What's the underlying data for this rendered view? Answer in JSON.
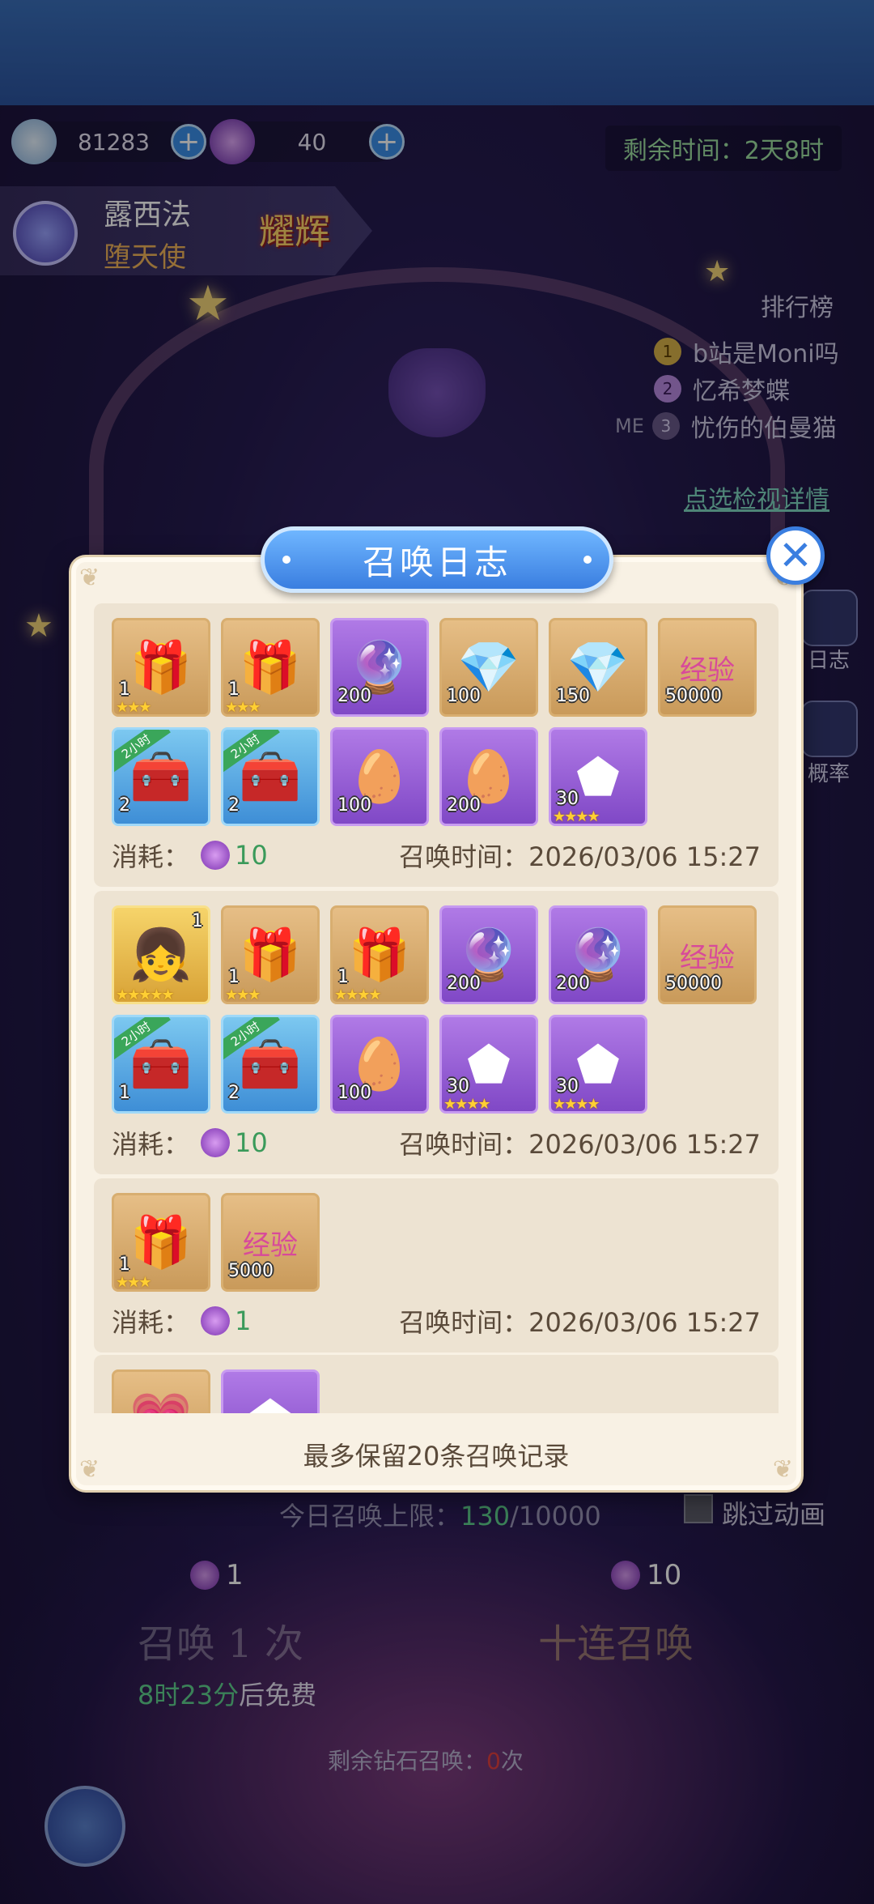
{
  "hud": {
    "coins": "81283",
    "gems": "40",
    "remaining_time": "剩余时间：2天8时"
  },
  "hero": {
    "name": "露西法",
    "title": "堕天使",
    "badge": "耀辉"
  },
  "ranking": {
    "title": "排行榜",
    "entries": [
      {
        "rank": "1",
        "name": "b站是Moni吗"
      },
      {
        "rank": "2",
        "name": "忆希梦蝶"
      },
      {
        "rank": "3",
        "name": "忧伤的伯曼猫"
      }
    ],
    "me_label": "ME",
    "detail_link": "点选检视详情"
  },
  "side_buttons": [
    {
      "label": "日志"
    },
    {
      "label": "概率"
    }
  ],
  "background_ui": {
    "daily_limit_label": "今日召唤上限：",
    "daily_limit_used": "130",
    "daily_limit_max": "/10000",
    "skip_animation": "跳过动画",
    "cost_single": "1",
    "cost_ten": "10",
    "summon_once": "召唤 1 次",
    "summon_ten": "十连召唤",
    "free_countdown": "8时23分",
    "free_suffix": "后免费",
    "diamond_left_label": "剩余钻石召唤：",
    "diamond_left_value": "0",
    "diamond_left_unit": "次"
  },
  "dialog": {
    "title": "召唤日志",
    "note": "最多保留20条召唤记录",
    "cost_label": "消耗：",
    "time_label": "召唤时间：",
    "records": [
      {
        "cost": "10",
        "time": "2026/03/06 15:27",
        "items": [
          {
            "kind": "mystery-box",
            "bg": "gold",
            "qty": "1",
            "stars": "★★★"
          },
          {
            "kind": "mystery-box",
            "bg": "gold",
            "qty": "1",
            "stars": "★★★"
          },
          {
            "kind": "crystal-ball",
            "bg": "purple",
            "qty": "200"
          },
          {
            "kind": "gem",
            "bg": "gold",
            "qty": "100"
          },
          {
            "kind": "gem",
            "bg": "gold",
            "qty": "150"
          },
          {
            "kind": "exp-heart",
            "bg": "gold",
            "qty": "50000",
            "text": "经验"
          },
          {
            "kind": "timed-chest",
            "bg": "blue",
            "qty": "2",
            "tag": "2小时"
          },
          {
            "kind": "timed-chest",
            "bg": "blue",
            "qty": "2",
            "tag": "2小时"
          },
          {
            "kind": "golden-egg",
            "bg": "purple",
            "qty": "100"
          },
          {
            "kind": "golden-egg",
            "bg": "purple",
            "qty": "200"
          },
          {
            "kind": "shard",
            "bg": "purple",
            "qty": "30",
            "stars": "★★★★"
          }
        ]
      },
      {
        "cost": "10",
        "time": "2026/03/06 15:27",
        "items": [
          {
            "kind": "character",
            "bg": "char",
            "qty": "",
            "level": "1",
            "stars": "★★★★★"
          },
          {
            "kind": "mystery-box",
            "bg": "gold",
            "qty": "1",
            "stars": "★★★"
          },
          {
            "kind": "mystery-box",
            "bg": "gold",
            "qty": "1",
            "stars": "★★★★"
          },
          {
            "kind": "crystal-ball",
            "bg": "purple",
            "qty": "200"
          },
          {
            "kind": "crystal-ball",
            "bg": "purple",
            "qty": "200"
          },
          {
            "kind": "exp-heart",
            "bg": "gold",
            "qty": "50000",
            "text": "经验"
          },
          {
            "kind": "timed-chest",
            "bg": "blue",
            "qty": "1",
            "tag": "2小时"
          },
          {
            "kind": "timed-chest",
            "bg": "blue",
            "qty": "2",
            "tag": "2小时"
          },
          {
            "kind": "golden-egg",
            "bg": "purple",
            "qty": "100"
          },
          {
            "kind": "shard",
            "bg": "purple",
            "qty": "30",
            "stars": "★★★★"
          },
          {
            "kind": "shard",
            "bg": "purple",
            "qty": "30",
            "stars": "★★★★"
          }
        ]
      },
      {
        "cost": "1",
        "time": "2026/03/06 15:27",
        "items": [
          {
            "kind": "mystery-box",
            "bg": "gold",
            "qty": "1",
            "stars": "★★★"
          },
          {
            "kind": "exp-heart",
            "bg": "gold",
            "qty": "5000",
            "text": "经验"
          }
        ]
      },
      {
        "cost": "",
        "time": "",
        "items": [
          {
            "kind": "exp-heart",
            "bg": "gold",
            "qty": ""
          },
          {
            "kind": "shard",
            "bg": "purple",
            "qty": ""
          }
        ]
      }
    ]
  },
  "colors": {
    "accent_blue": "#3a7ee0",
    "dialog_bg": "#f8f1e4",
    "cost_green": "#3a9a5a",
    "remaining_time_green": "#9ddfa0"
  }
}
